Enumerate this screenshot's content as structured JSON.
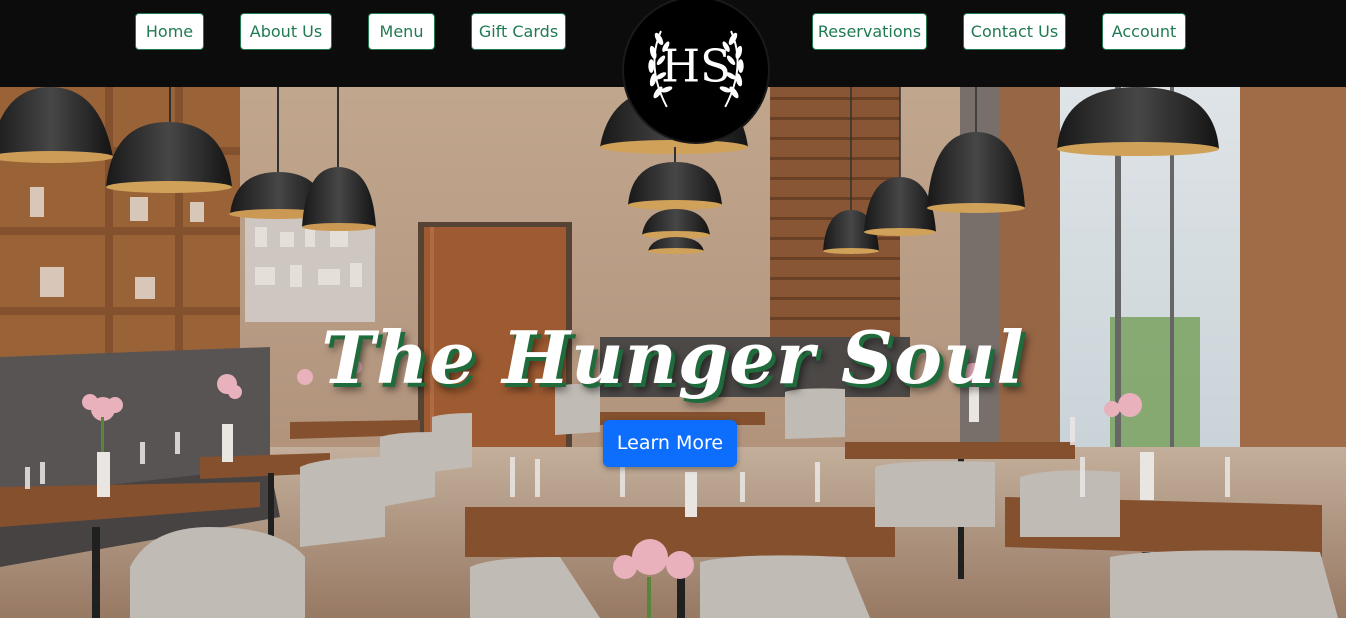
{
  "nav": {
    "left": [
      {
        "label": "Home"
      },
      {
        "label": "About Us"
      },
      {
        "label": "Menu"
      },
      {
        "label": "Gift Cards"
      }
    ],
    "right": [
      {
        "label": "Reservations"
      },
      {
        "label": "Contact Us"
      },
      {
        "label": "Account"
      }
    ]
  },
  "logo": {
    "letters": "HS"
  },
  "hero": {
    "title": "The Hunger Soul",
    "cta_label": "Learn More"
  },
  "colors": {
    "nav_bg": "#0c0c0c",
    "nav_button_text": "#1f7a52",
    "cta_bg": "#0d6efd",
    "title_shadow": "#1f6b3c"
  }
}
